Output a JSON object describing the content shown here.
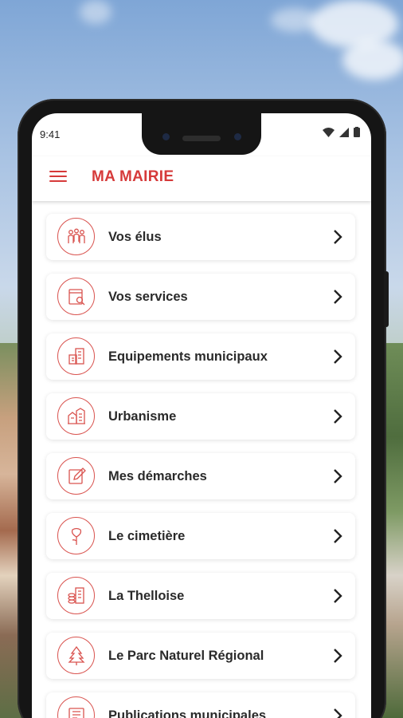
{
  "status_bar": {
    "time": "9:41"
  },
  "app_bar": {
    "title": "MA MAIRIE"
  },
  "menu_items": [
    {
      "label": "Vos élus",
      "icon": "people-icon"
    },
    {
      "label": "Vos services",
      "icon": "services-icon"
    },
    {
      "label": "Equipements municipaux",
      "icon": "buildings-icon"
    },
    {
      "label": "Urbanisme",
      "icon": "city-icon"
    },
    {
      "label": "Mes démarches",
      "icon": "edit-icon"
    },
    {
      "label": "Le cimetière",
      "icon": "flower-icon"
    },
    {
      "label": "La Thelloise",
      "icon": "coins-icon"
    },
    {
      "label": "Le Parc Naturel Régional",
      "icon": "tree-icon"
    },
    {
      "label": "Publications municipales",
      "icon": "publication-icon"
    }
  ],
  "colors": {
    "accent": "#d63a3a",
    "icon_stroke": "#d9534f"
  }
}
